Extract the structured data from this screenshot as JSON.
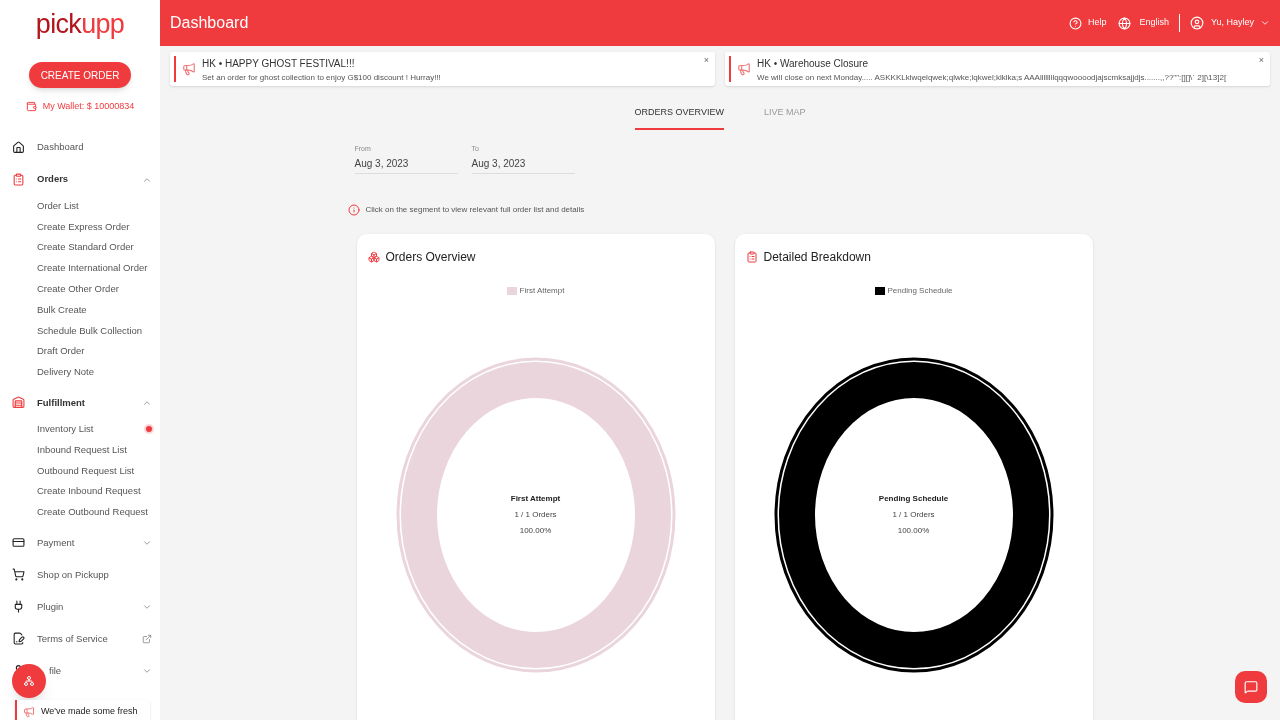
{
  "logo": {
    "text_dark": "pick",
    "text_accent": "upp"
  },
  "sidebar": {
    "create_button": "CREATE ORDER",
    "wallet": "My Wallet: $ 10000834",
    "items": [
      {
        "kind": "link",
        "label": "Dashboard"
      },
      {
        "kind": "section",
        "label": "Orders",
        "expanded": true,
        "children": [
          {
            "label": "Order List",
            "dot": false
          },
          {
            "label": "Create Express Order",
            "dot": false
          },
          {
            "label": "Create Standard Order",
            "dot": false
          },
          {
            "label": "Create International Order",
            "dot": false
          },
          {
            "label": "Create Other Order",
            "dot": false
          },
          {
            "label": "Bulk Create",
            "dot": false
          },
          {
            "label": "Schedule Bulk Collection",
            "dot": false
          },
          {
            "label": "Draft Order",
            "dot": false
          },
          {
            "label": "Delivery Note",
            "dot": false
          }
        ]
      },
      {
        "kind": "section",
        "label": "Fulfillment",
        "expanded": true,
        "children": [
          {
            "label": "Inventory List",
            "dot": true
          },
          {
            "label": "Inbound Request List",
            "dot": false
          },
          {
            "label": "Outbound Request List",
            "dot": false
          },
          {
            "label": "Create Inbound Request",
            "dot": false
          },
          {
            "label": "Create Outbound Request",
            "dot": false
          }
        ]
      },
      {
        "kind": "section",
        "label": "Payment",
        "expanded": false
      },
      {
        "kind": "link",
        "label": "Shop on Pickupp"
      },
      {
        "kind": "section",
        "label": "Plugin",
        "expanded": false
      },
      {
        "kind": "external",
        "label": "Terms of Service"
      },
      {
        "kind": "section",
        "label": "file",
        "expanded": false
      }
    ]
  },
  "header": {
    "title": "Dashboard",
    "help": "Help",
    "language": "English",
    "user": "Yu, Hayley"
  },
  "announcements": [
    {
      "title": "HK • HAPPY GHOST FESTIVAL!!!",
      "body": "Set an order for ghost collection to enjoy G$100 discount ! Hurray!!!",
      "close": "×"
    },
    {
      "title": "HK • Warehouse Closure",
      "body": "We will close on next Monday..... ASKKKLklwqelqwek;qlwke;lqkwel;klklka;s AAAllllllllqqqwoooodjajscmksajjdjs.......,,??\"\":[][]\\` 2][\\13]2[",
      "close": "×"
    }
  ],
  "tabs": [
    {
      "label": "ORDERS OVERVIEW",
      "selected": true
    },
    {
      "label": "LIVE MAP",
      "selected": false
    }
  ],
  "dates": [
    {
      "label": "From",
      "value": "Aug 3, 2023"
    },
    {
      "label": "To",
      "value": "Aug 3, 2023"
    }
  ],
  "hint": "Click on the segment to view relevant full order list and details",
  "cards": [
    {
      "title": "Orders Overview",
      "legend": {
        "label": "First Attempt",
        "color": "#ebd5dd"
      },
      "center": {
        "name": "First Attempt",
        "count": "1 / 1 Orders",
        "percent": "100.00%"
      }
    },
    {
      "title": "Detailed Breakdown",
      "legend": {
        "label": "Pending Schedule",
        "color": "#000000"
      },
      "center": {
        "name": "Pending Schedule",
        "count": "1 / 1 Orders",
        "percent": "100.00%"
      }
    }
  ],
  "toast": {
    "text": "We've made some fresh"
  }
}
